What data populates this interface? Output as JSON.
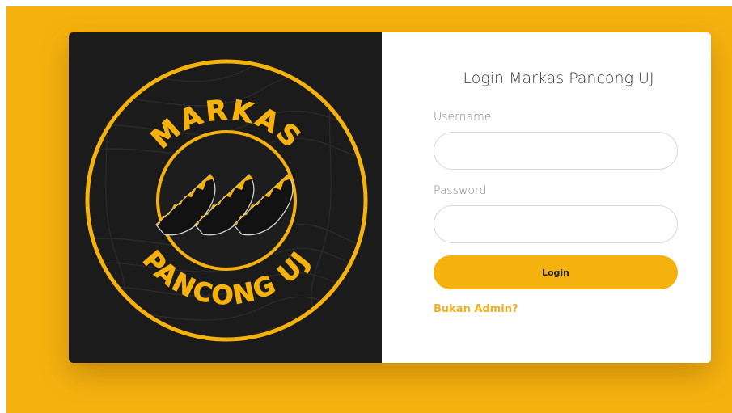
{
  "brand": {
    "top_text": "MARKAS",
    "bottom_text": "PANCONG UJ"
  },
  "login": {
    "title": "Login Markas Pancong UJ",
    "username_label": "Username",
    "username_value": "",
    "password_label": "Password",
    "password_value": "",
    "button_label": "Login",
    "admin_link": "Bukan Admin?"
  },
  "colors": {
    "accent": "#f5b20f",
    "logo_dark": "#1b1b1b",
    "link": "#f2b021"
  }
}
